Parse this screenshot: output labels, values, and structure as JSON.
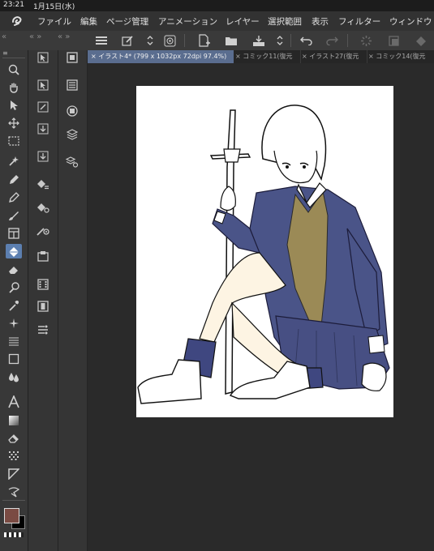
{
  "status": {
    "time": "23:21",
    "date": "1月15日(水)"
  },
  "menu": {
    "items": [
      "ファイル",
      "編集",
      "ページ管理",
      "アニメーション",
      "レイヤー",
      "選択範囲",
      "表示",
      "フィルター",
      "ウィンドウ"
    ]
  },
  "toolbar": {
    "buttons": [
      "menu-icon",
      "edit-icon",
      "stepper-icon",
      "spiral-icon",
      "new-file-icon",
      "open-folder-icon",
      "save-icon",
      "stepper-icon",
      "undo-icon",
      "redo-icon",
      "spinner-icon",
      "clear-icon",
      "fill-icon"
    ]
  },
  "tabs": [
    {
      "label": "イラスト4* (799 x 1032px 72dpi 97.4%)",
      "active": true
    },
    {
      "label": "コミック11(復元",
      "active": false
    },
    {
      "label": "イラスト27(復元",
      "active": false
    },
    {
      "label": "コミック14(復元",
      "active": false
    }
  ],
  "tools": [
    "zoom-icon",
    "hand-icon",
    "operation-icon",
    "move-icon",
    "selection-icon",
    "auto-select-icon",
    "pen-icon",
    "pencil-icon",
    "brush-icon",
    "frame-icon",
    "fill-icon",
    "eraser-icon",
    "blend-icon",
    "eyedropper-icon",
    "sparkle-icon",
    "lines-icon",
    "rectangle-icon",
    "drops-icon",
    "text-icon",
    "gradient-icon",
    "correction-icon",
    "decoration-icon",
    "ruler-icon",
    "balloon-icon"
  ],
  "colors": {
    "main": "#7a4b43",
    "sub": "#000000",
    "accent": "#5c7fb0"
  }
}
